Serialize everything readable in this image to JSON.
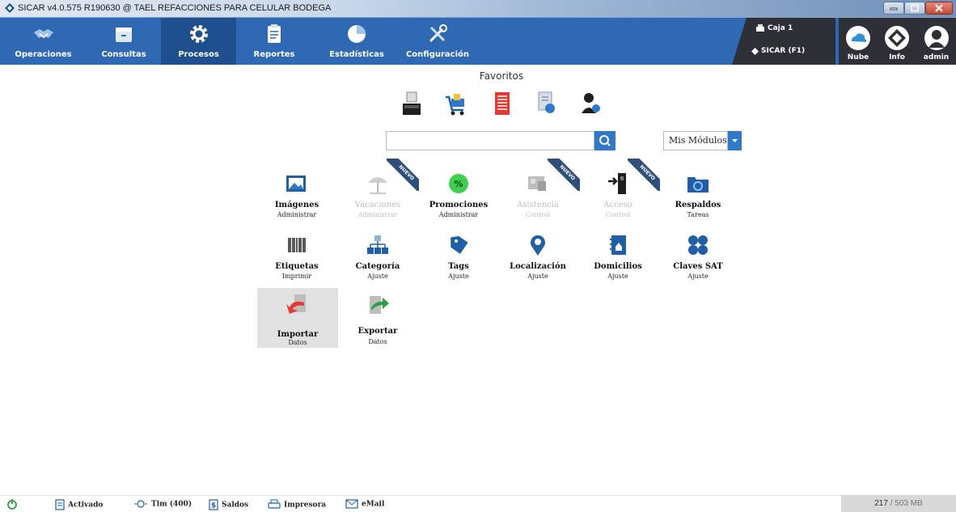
{
  "window": {
    "title": "SICAR v4.0.575 R190630 @ TAEL REFACCIONES PARA CELULAR BODEGA"
  },
  "nav": {
    "items": [
      {
        "label": "Operaciones",
        "icon": "handshake-icon"
      },
      {
        "label": "Consultas",
        "icon": "archive-box-icon"
      },
      {
        "label": "Procesos",
        "icon": "gear-icon",
        "active": true
      },
      {
        "label": "Reportes",
        "icon": "clipboard-icon"
      },
      {
        "label": "Estadísticas",
        "icon": "pie-chart-icon"
      },
      {
        "label": "Configuración",
        "icon": "tools-icon"
      }
    ],
    "caja": "Caja 1",
    "sicar": "SICAR (F1)",
    "right": [
      {
        "label": "Nube",
        "icon": "cloud-icon"
      },
      {
        "label": "Info",
        "icon": "info-icon"
      },
      {
        "label": "admin",
        "icon": "user-icon"
      }
    ]
  },
  "favoritos": {
    "title": "Favoritos",
    "icons": [
      "cash-register-icon",
      "shopping-cart-icon",
      "document-list-icon",
      "document-search-icon",
      "user-settings-icon"
    ]
  },
  "search": {
    "value": "",
    "placeholder": ""
  },
  "modules_select": {
    "label": "Mis Módulos"
  },
  "modules": [
    {
      "name": "Imágenes",
      "sub": "Administrar",
      "icon": "images-icon"
    },
    {
      "name": "Vacaciones",
      "sub": "Administrar",
      "icon": "beach-umbrella-icon",
      "disabled": true,
      "badge": "NUEVO"
    },
    {
      "name": "Promociones",
      "sub": "Administrar",
      "icon": "percent-icon"
    },
    {
      "name": "Asistencia",
      "sub": "Control",
      "icon": "time-clock-icon",
      "disabled": true,
      "badge": "NUEVO"
    },
    {
      "name": "Acceso",
      "sub": "Control",
      "icon": "door-access-icon",
      "disabled": true,
      "badge": "NUEVO"
    },
    {
      "name": "Respaldos",
      "sub": "Tareas",
      "icon": "backup-folder-icon"
    },
    {
      "name": "Etiquetas",
      "sub": "Imprimir",
      "icon": "barcode-icon"
    },
    {
      "name": "Categoría",
      "sub": "Ajuste",
      "icon": "hierarchy-icon"
    },
    {
      "name": "Tags",
      "sub": "Ajuste",
      "icon": "tag-icon"
    },
    {
      "name": "Localización",
      "sub": "Ajuste",
      "icon": "location-pin-icon"
    },
    {
      "name": "Domicilios",
      "sub": "Ajuste",
      "icon": "address-book-icon"
    },
    {
      "name": "Claves SAT",
      "sub": "Ajuste",
      "icon": "four-dots-icon"
    },
    {
      "name": "Importar",
      "sub": "Datos",
      "icon": "import-icon",
      "selected": true
    },
    {
      "name": "Exportar",
      "sub": "Datos",
      "icon": "export-icon"
    }
  ],
  "status": {
    "activado": "Activado",
    "tim": "Tim (400)",
    "saldos": "Saldos",
    "impresora": "Impresora",
    "email": "eMail",
    "memory_used": "217",
    "memory_total": " / 503 MB"
  },
  "colors": {
    "toolbar": "#2f69b3",
    "toolbar_active": "#1f4f8f",
    "accent": "#2f79c8",
    "badge": "#2f4f7a"
  }
}
